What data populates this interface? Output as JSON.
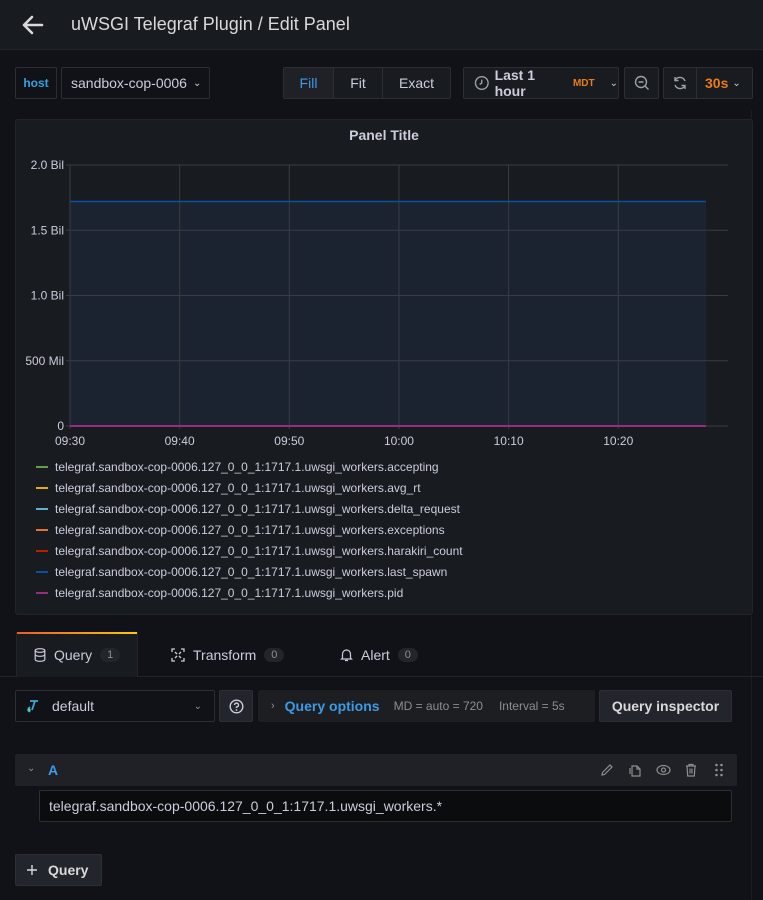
{
  "header": {
    "title": "uWSGI Telegraf Plugin / Edit Panel",
    "back_icon": "arrow-left-icon"
  },
  "variables": {
    "label": "host",
    "value": "sandbox-cop-0006"
  },
  "view_mode": {
    "options": [
      "Fill",
      "Fit",
      "Exact"
    ],
    "selected": "Fill"
  },
  "time_picker": {
    "range": "Last 1 hour",
    "timezone": "MDT",
    "refresh_interval": "30s"
  },
  "panel": {
    "title": "Panel Title"
  },
  "chart_data": {
    "type": "area",
    "title": "Panel Title",
    "xlabel": "",
    "ylabel": "",
    "x_ticks": [
      "09:30",
      "09:40",
      "09:50",
      "10:00",
      "10:10",
      "10:20"
    ],
    "x_range": [
      "09:30",
      "10:28"
    ],
    "y_ticks": [
      "0",
      "500 Mil",
      "1.0 Bil",
      "1.5 Bil",
      "2.0 Bil"
    ],
    "y_tick_values": [
      0,
      500000000,
      1000000000,
      1500000000,
      2000000000
    ],
    "ylim": [
      0,
      2000000000
    ],
    "grid": true,
    "legend_position": "bottom",
    "series": [
      {
        "name": "telegraf.sandbox-cop-0006.127_0_0_1:1717.1.uwsgi_workers.accepting",
        "color": "#73bf69",
        "values": [
          1,
          1
        ]
      },
      {
        "name": "telegraf.sandbox-cop-0006.127_0_0_1:1717.1.uwsgi_workers.avg_rt",
        "color": "#fade2a",
        "values": [
          0,
          0
        ]
      },
      {
        "name": "telegraf.sandbox-cop-0006.127_0_0_1:1717.1.uwsgi_workers.delta_request",
        "color": "#5794f2",
        "values": [
          0,
          0
        ]
      },
      {
        "name": "telegraf.sandbox-cop-0006.127_0_0_1:1717.1.uwsgi_workers.exceptions",
        "color": "#ff9830",
        "values": [
          0,
          0
        ]
      },
      {
        "name": "telegraf.sandbox-cop-0006.127_0_0_1:1717.1.uwsgi_workers.harakiri_count",
        "color": "#f2495c",
        "values": [
          0,
          0
        ]
      },
      {
        "name": "telegraf.sandbox-cop-0006.127_0_0_1:1717.1.uwsgi_workers.last_spawn",
        "color": "#3274d9",
        "values": [
          1720000000,
          1720000000
        ]
      },
      {
        "name": "telegraf.sandbox-cop-0006.127_0_0_1:1717.1.uwsgi_workers.pid",
        "color": "#b877d9",
        "values": [
          3000,
          3000
        ]
      }
    ]
  },
  "legend_colors": [
    "#629e51",
    "#e5ac0e",
    "#64b0c8",
    "#e0752d",
    "#bf1b00",
    "#0a50a1",
    "#962d82"
  ],
  "tabs": [
    {
      "label": "Query",
      "count": "1",
      "icon": "database-icon"
    },
    {
      "label": "Transform",
      "count": "0",
      "icon": "transform-icon"
    },
    {
      "label": "Alert",
      "count": "0",
      "icon": "bell-icon"
    }
  ],
  "query_editor": {
    "datasource": "default",
    "query_options_label": "Query options",
    "max_data_points": "MD = auto = 720",
    "interval": "Interval = 5s",
    "inspector_label": "Query inspector",
    "queries": [
      {
        "ref_id": "A",
        "target": "telegraf.sandbox-cop-0006.127_0_0_1:1717.1.uwsgi_workers.*"
      }
    ],
    "add_query_label": "Query"
  }
}
